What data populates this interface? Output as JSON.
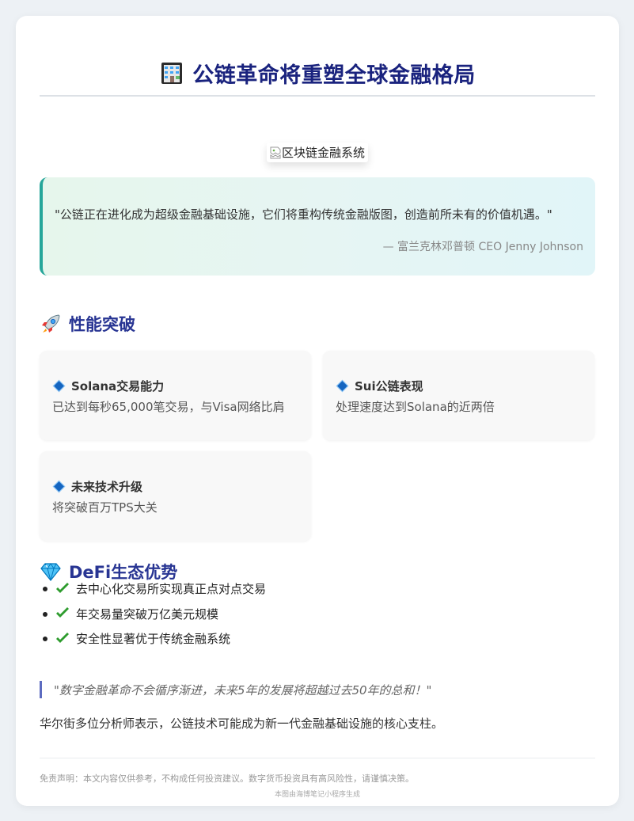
{
  "header": {
    "title": "公链革命将重塑全球金融格局",
    "icon": "office-building-icon"
  },
  "hero": {
    "alt_text": "区块链金融系统",
    "icon": "broken-image-icon"
  },
  "quote": {
    "text": "\"公链正在进化成为超级金融基础设施，它们将重构传统金融版图，创造前所未有的价值机遇。\"",
    "author": "— 富兰克林邓普顿 CEO Jenny Johnson"
  },
  "performance": {
    "icon": "rocket-icon",
    "title": "性能突破",
    "items": [
      {
        "title": "Solana交易能力",
        "desc": "已达到每秒65,000笔交易，与Visa网络比肩"
      },
      {
        "title": "Sui公链表现",
        "desc": "处理速度达到Solana的近两倍"
      },
      {
        "title": "未来技术升级",
        "desc": "将突破百万TPS大关"
      }
    ]
  },
  "defi": {
    "icon": "gem-icon",
    "title": "DeFi生态优势",
    "items": [
      {
        "text": "去中心化交易所实现真正点对点交易"
      },
      {
        "text": "年交易量突破万亿美元规模"
      },
      {
        "text": "安全性显著优于传统金融系统"
      }
    ]
  },
  "pull_quote": "\"数字金融革命不会循序渐进，未来5年的发展将超越过去50年的总和！\"",
  "analyst_note": "华尔街多位分析师表示，公链技术可能成为新一代金融基础设施的核心支柱。",
  "footer": {
    "disclaimer": "免责声明：本文内容仅供参考，不构成任何投资建议。数字货币投资具有高风险性，请谨慎决策。",
    "generated_by": "本图由海博笔记小程序生成"
  },
  "colors": {
    "title": "#1a237e",
    "section_title": "#283593",
    "quote_border": "#26a69a",
    "pull_quote_border": "#5c6bc0",
    "check": "#2e9c2e"
  }
}
